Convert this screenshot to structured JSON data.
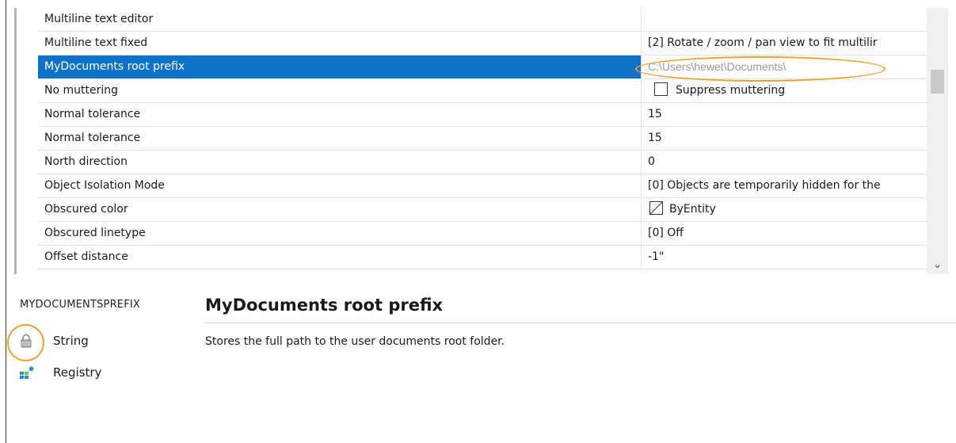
{
  "grid": {
    "rows": [
      {
        "name": "Multiline text editor",
        "value": ""
      },
      {
        "name": "Multiline text fixed",
        "value": "[2] Rotate / zoom / pan view to fit multilir"
      },
      {
        "name": "MyDocuments root prefix",
        "value": "C:\\Users\\hewet\\Documents\\",
        "selected": true
      },
      {
        "name": "No muttering",
        "value": "Suppress muttering",
        "control": "checkbox",
        "checked": false
      },
      {
        "name": "Normal tolerance",
        "value": "15"
      },
      {
        "name": "Normal tolerance",
        "value": "15"
      },
      {
        "name": "North direction",
        "value": "0"
      },
      {
        "name": "Object Isolation Mode",
        "value": "[0] Objects are temporarily hidden for the"
      },
      {
        "name": "Obscured color",
        "value": "ByEntity",
        "control": "color-swatch"
      },
      {
        "name": "Obscured linetype",
        "value": "[0] Off"
      },
      {
        "name": "Offset distance",
        "value": "-1\""
      }
    ]
  },
  "help": {
    "variable_name": "MYDOCUMENTSPREFIX",
    "title": "MyDocuments root prefix",
    "description": "Stores the full path to the user documents root folder.",
    "type_label": "String",
    "type_icon": "lock-icon",
    "storage_label": "Registry",
    "storage_icon": "registry-icon"
  },
  "colors": {
    "selection": "#0f72c9",
    "highlight_oval": "#f3a12d"
  }
}
